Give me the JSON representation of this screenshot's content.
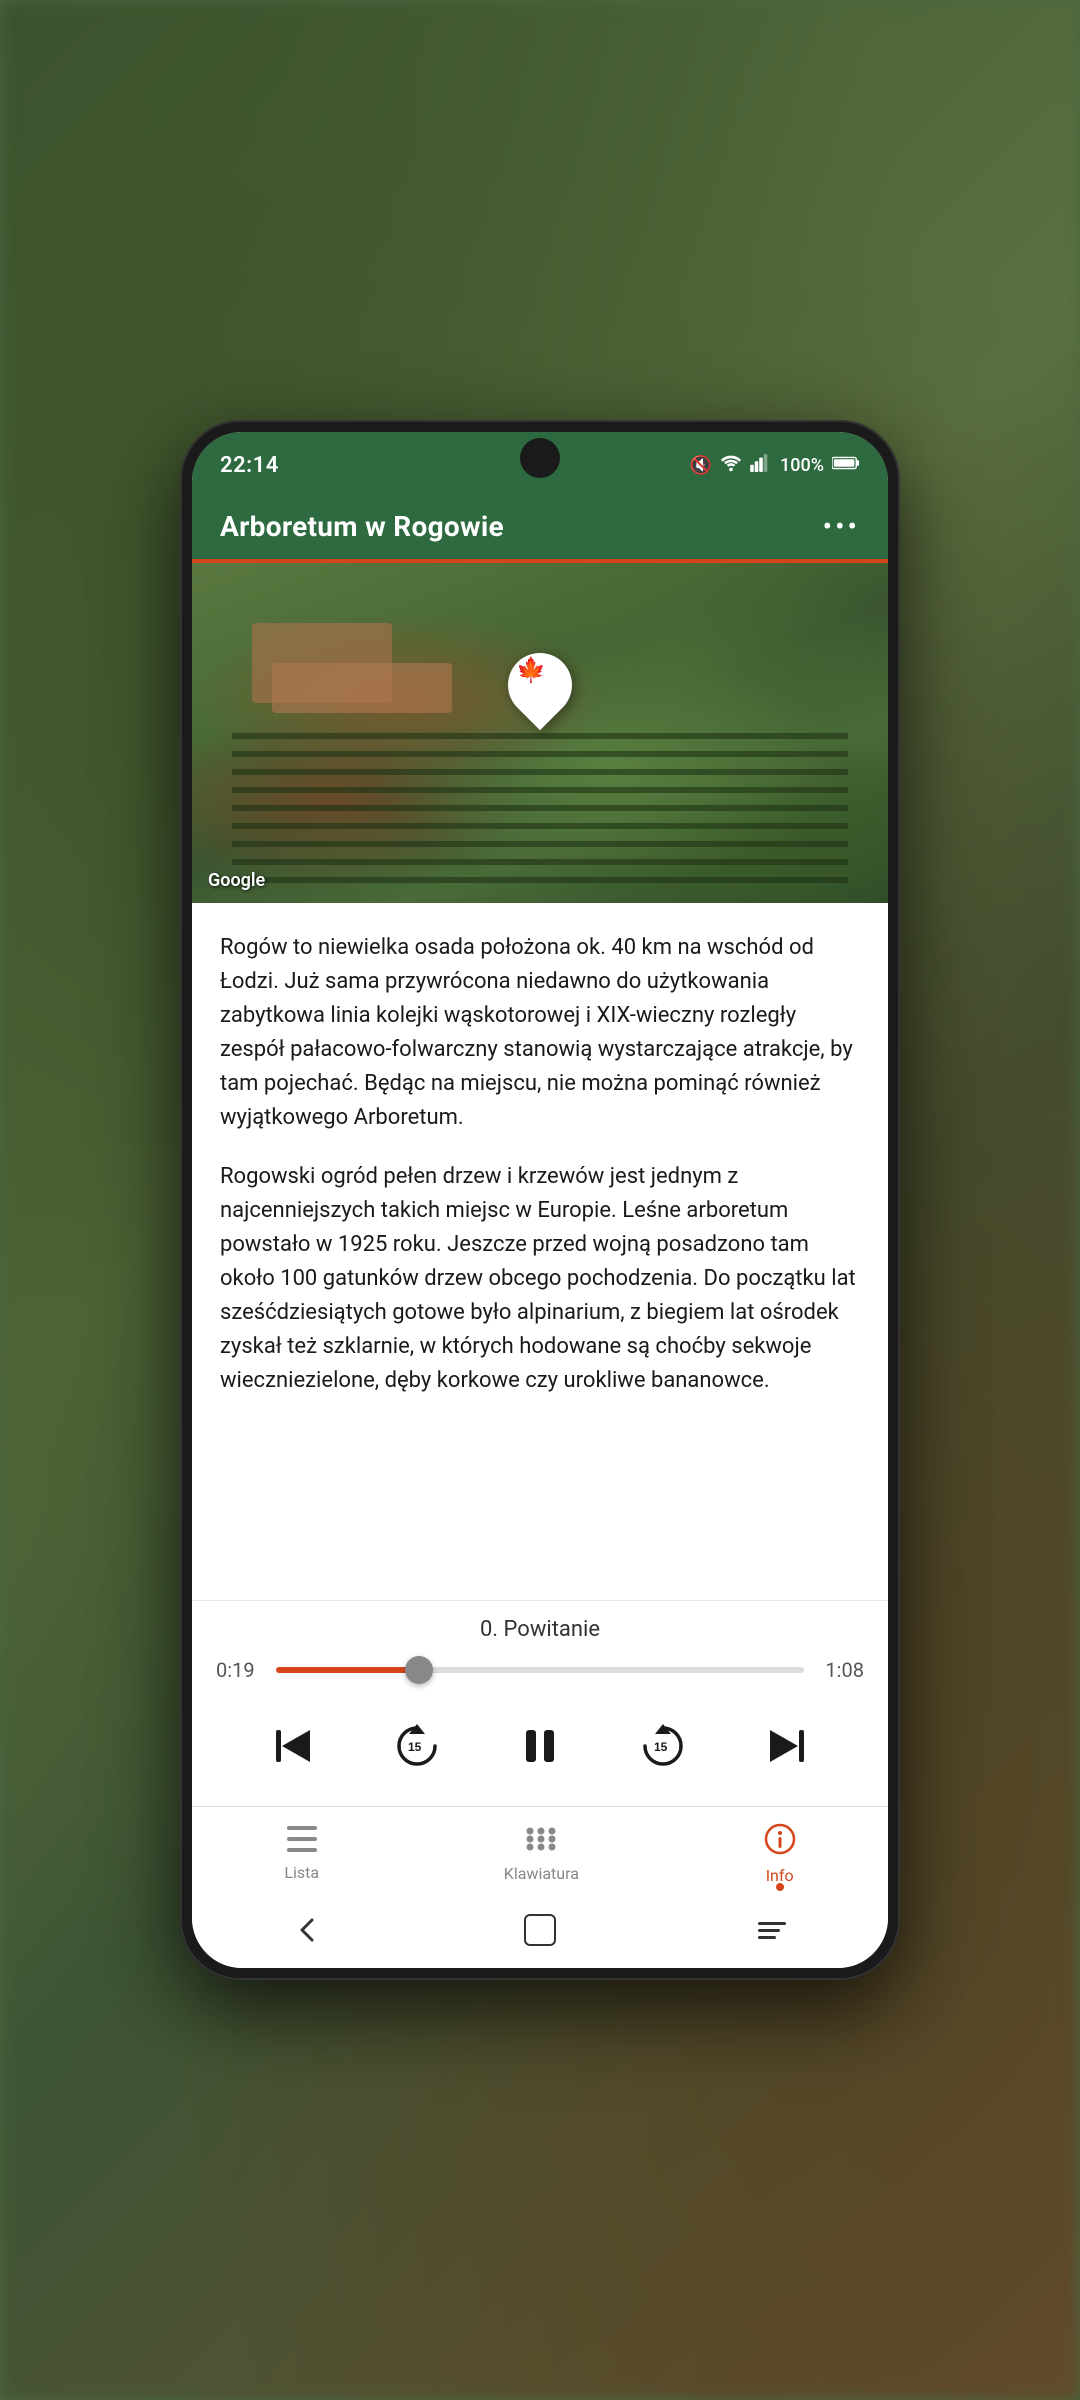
{
  "status": {
    "time": "22:14",
    "battery": "100%",
    "signal_icons": "📵 ⊙ |||"
  },
  "header": {
    "title": "Arboretum w Rogowie",
    "more_label": "•••"
  },
  "map": {
    "google_label": "Google"
  },
  "content": {
    "paragraph1": "Rogów to niewielka osada położona ok. 40 km na wschód od Łodzi. Już sama przywrócona niedawno do użytkowania zabytkowa linia kolejki wąskotorowej i XIX-wieczny rozległy zespół pałacowo-folwarczny stanowią wystarczające atrakcje, by tam pojechać. Będąc na miejscu, nie można pominąć również wyjątkowego Arboretum.",
    "paragraph2": "Rogowski ogród pełen drzew i krzewów jest jednym z najcenniejszych takich miejsc w Europie. Leśne arboretum powstało w 1925 roku. Jeszcze przed wojną posadzono tam około 100 gatunków drzew obcego pochodzenia. Do początku lat sześćdziesiątych gotowe było alpinarium, z biegiem lat ośrodek zyskał też szklarnie, w których hodowane są choćby sekwoje wieczniezielone, dęby korkowe czy urokliwe bananowce."
  },
  "player": {
    "track_title": "0. Powitanie",
    "time_current": "0:19",
    "time_total": "1:08",
    "progress_percent": 27
  },
  "bottom_nav": {
    "items": [
      {
        "id": "lista",
        "label": "Lista",
        "active": false
      },
      {
        "id": "klawiatura",
        "label": "Klawiatura",
        "active": false
      },
      {
        "id": "info",
        "label": "Info",
        "active": true
      }
    ]
  }
}
